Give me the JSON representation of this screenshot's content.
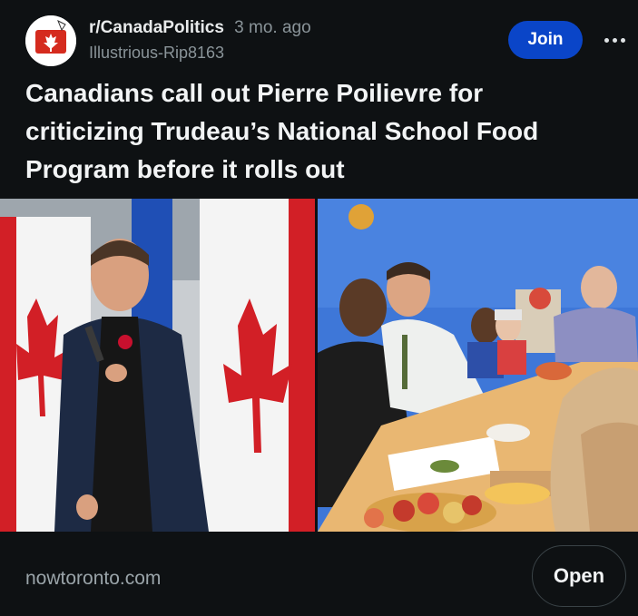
{
  "post": {
    "subreddit": "r/CanadaPolitics",
    "time_ago": "3 mo. ago",
    "author": "Illustrious-Rip8163",
    "join_label": "Join",
    "more_icon": "more-options-icon",
    "title": "Canadians call out Pierre Poilievre for criticizing Trudeau’s National School Food Program before it rolls out",
    "link_domain": "nowtoronto.com",
    "open_label": "Open"
  },
  "colors": {
    "background": "#0e1113",
    "join_button": "#0a45c8",
    "subreddit_icon_red": "#d52b1e",
    "muted_text": "#8a9499"
  }
}
